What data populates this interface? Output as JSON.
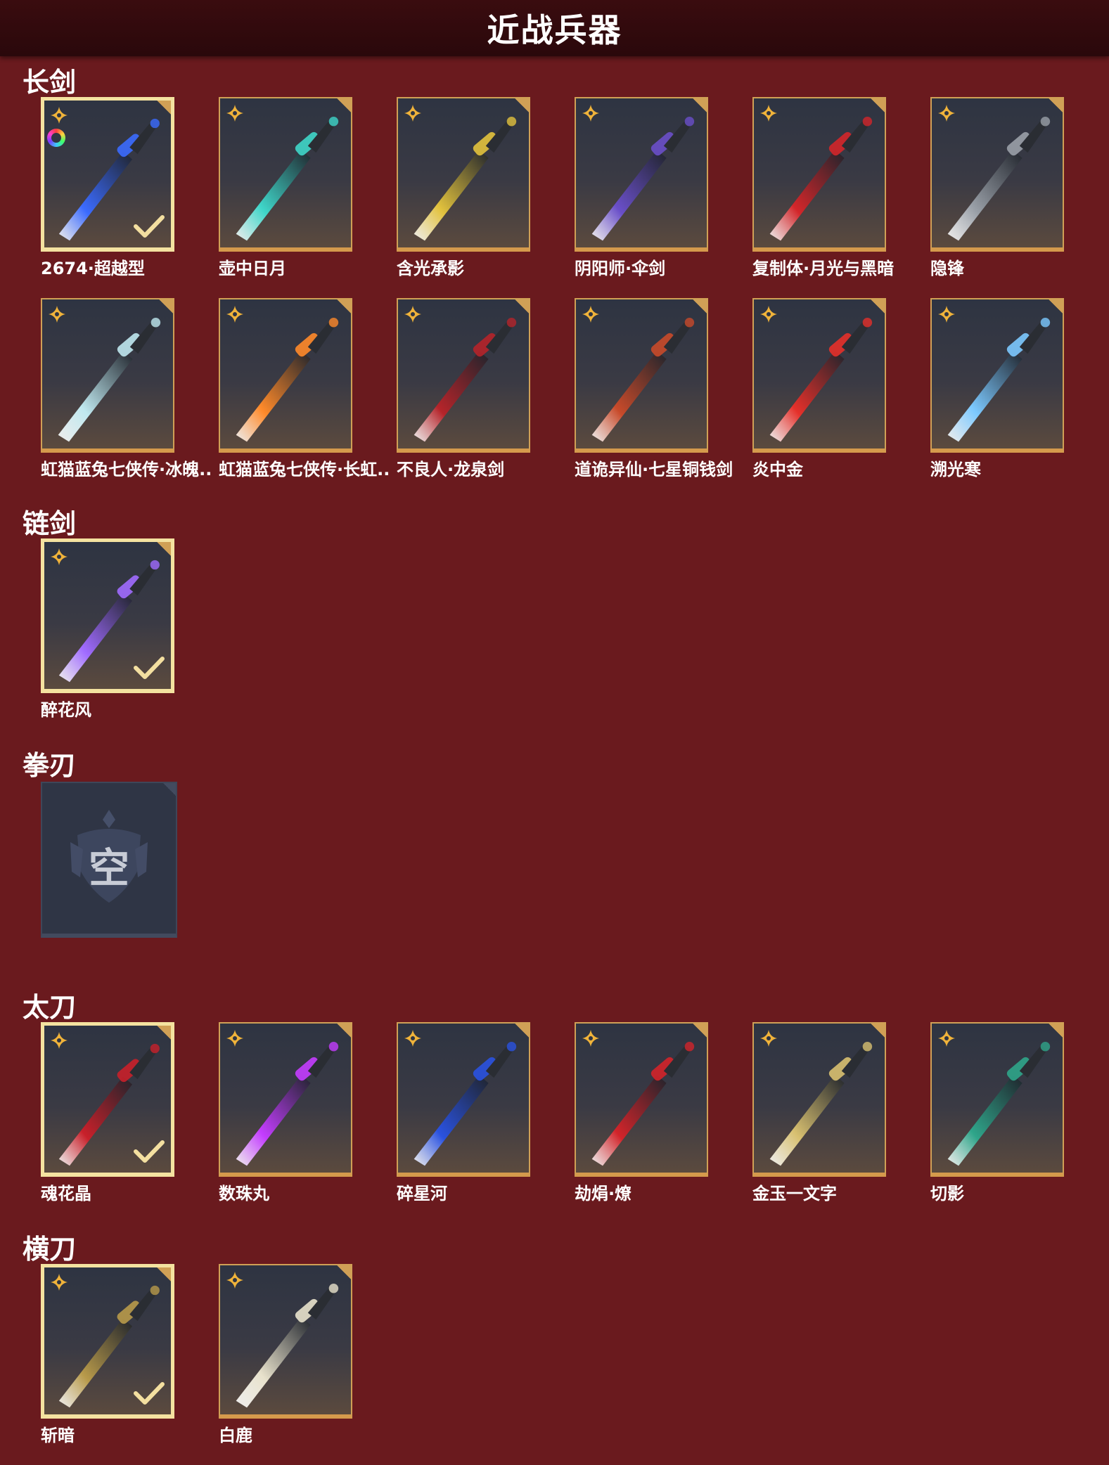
{
  "header": {
    "title": "近战兵器"
  },
  "sections": {
    "long_sword": {
      "title": "长剑",
      "items": [
        {
          "label": "2674·超越型",
          "selected": true,
          "colorful": true,
          "color": "#3b6bff"
        },
        {
          "label": "壶中日月",
          "color": "#3fd6c9"
        },
        {
          "label": "含光承影",
          "color": "#e2c23d"
        },
        {
          "label": "阴阳师·伞剑",
          "color": "#6a4fc9"
        },
        {
          "label": "复制体·月光与黑暗",
          "color": "#d3262a"
        },
        {
          "label": "隐锋",
          "color": "#9aa0a8"
        },
        {
          "label": "虹猫蓝兔七侠传·冰魄..",
          "color": "#bfe8ef"
        },
        {
          "label": "虹猫蓝兔七侠传·长虹..",
          "color": "#ff8a2a"
        },
        {
          "label": "不良人·龙泉剑",
          "color": "#b5242a"
        },
        {
          "label": "道诡异仙·七星铜钱剑",
          "color": "#c84a2a"
        },
        {
          "label": "炎中金",
          "color": "#e5302a"
        },
        {
          "label": "溯光寒",
          "color": "#7cc9ff"
        }
      ]
    },
    "chain_sword": {
      "title": "链剑",
      "items": [
        {
          "label": "醉花风",
          "selected": true,
          "color": "#a06bff"
        }
      ]
    },
    "fist_blade": {
      "title": "拳刃",
      "empty_text": "空"
    },
    "tachi": {
      "title": "太刀",
      "items": [
        {
          "label": "魂花晶",
          "selected": true,
          "color": "#c8202a"
        },
        {
          "label": "数珠丸",
          "color": "#c43dff"
        },
        {
          "label": "碎星河",
          "color": "#2a52e0"
        },
        {
          "label": "劫焆·燎",
          "color": "#d2242a"
        },
        {
          "label": "金玉一文字",
          "color": "#d8c070"
        },
        {
          "label": "切影",
          "color": "#2fa58a"
        }
      ]
    },
    "horizontal_blade": {
      "title": "横刀",
      "items": [
        {
          "label": "斩暗",
          "selected": true,
          "color": "#b89a4a"
        },
        {
          "label": "白鹿",
          "color": "#e8e2cc"
        }
      ]
    }
  }
}
